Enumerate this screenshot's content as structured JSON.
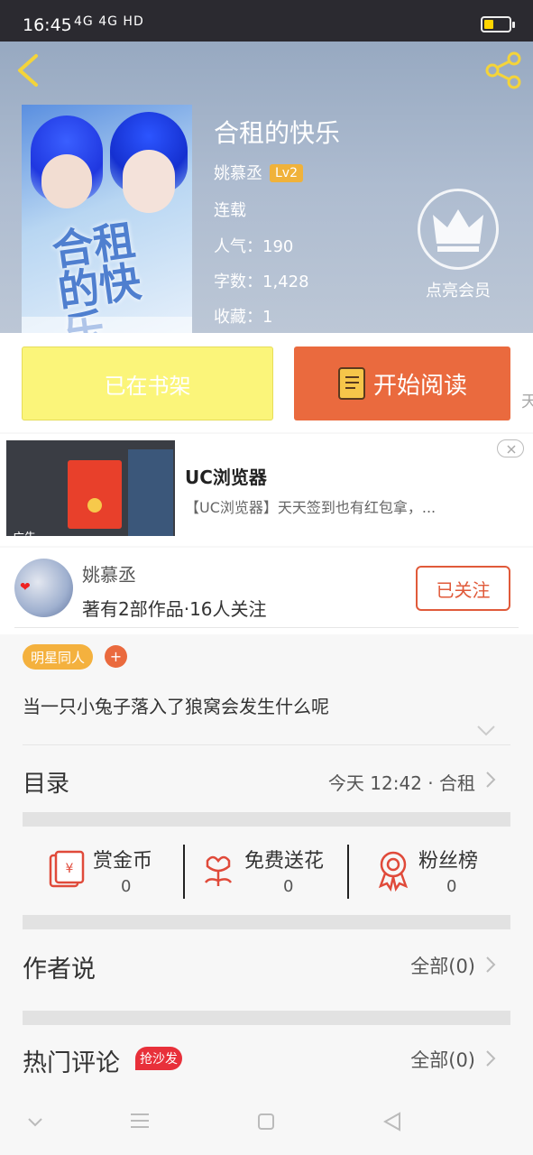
{
  "status_bar": {
    "time": "16:45",
    "network": "4G 4G HD"
  },
  "header": {
    "book_title": "合租的快乐",
    "author": "姚慕丞",
    "level": "Lv2",
    "status": "连载",
    "popularity": "人气：190",
    "word_count": "字数：1,428",
    "favorites": "收藏：1",
    "vip_label": "点亮会员",
    "cover_text": "合租的快乐"
  },
  "actions": {
    "shelf_label": "已在书架",
    "read_label": "开始阅读",
    "peek_label": "天"
  },
  "ad": {
    "title": "UC浏览器",
    "description": "【UC浏览器】天天签到也有红包拿，...",
    "ad_label": "广告"
  },
  "author_card": {
    "name": "姚慕丞",
    "meta": "著有2部作品·16人关注",
    "follow_label": "已关注"
  },
  "tags": {
    "tag1": "明星同人",
    "add": "+"
  },
  "description": "当一只小兔子落入了狼窝会发生什么呢",
  "toc": {
    "label": "目录",
    "latest": "今天 12:42 · 合租"
  },
  "stats": {
    "reward": {
      "label": "赏金币",
      "value": "0"
    },
    "flower": {
      "label": "免费送花",
      "value": "0"
    },
    "fans": {
      "label": "粉丝榜",
      "value": "0"
    }
  },
  "author_says": {
    "label": "作者说",
    "link": "全部(0)"
  },
  "hot_comments": {
    "label": "热门评论",
    "badge": "抢沙发",
    "link": "全部(0)"
  },
  "colors": {
    "accent": "#ea6a3e",
    "shelf": "#fbf57a",
    "tag": "#f4b13e",
    "badge": "#e8303a"
  }
}
